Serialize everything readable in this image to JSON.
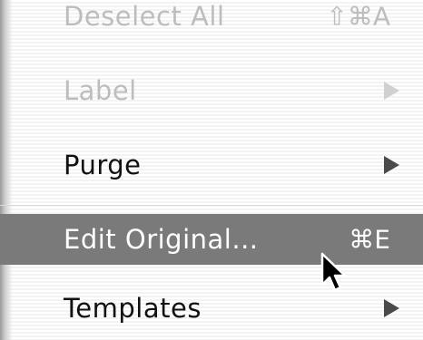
{
  "menu": {
    "items": [
      {
        "label": "Deselect All",
        "shortcut": "⇧⌘A",
        "enabled": false,
        "submenu": false
      },
      {
        "label": "Label",
        "shortcut": "",
        "enabled": false,
        "submenu": true
      },
      {
        "label": "Purge",
        "shortcut": "",
        "enabled": true,
        "submenu": true
      },
      {
        "label": "Edit Original...",
        "shortcut": "⌘E",
        "enabled": true,
        "submenu": false,
        "highlighted": true
      },
      {
        "label": "Templates",
        "shortcut": "",
        "enabled": true,
        "submenu": true
      }
    ]
  },
  "colors": {
    "highlight": "#7a7a7a",
    "disabled_text": "#bdbdbd",
    "text": "#111111"
  }
}
